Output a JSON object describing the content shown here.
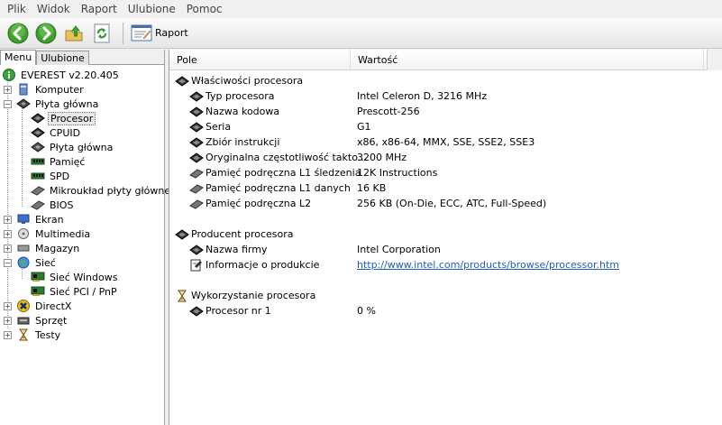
{
  "menu": [
    "Plik",
    "Widok",
    "Raport",
    "Ulubione",
    "Pomoc"
  ],
  "toolbar": {
    "report_label": "Raport"
  },
  "tabs": {
    "menu": "Menu",
    "favorites": "Ulubione"
  },
  "tree": {
    "root": "EVEREST v2.20.405",
    "komputer": "Komputer",
    "plyta": "Płyta główna",
    "procesor": "Procesor",
    "cpuid": "CPUID",
    "plyta_sub": "Płyta główna",
    "pamiec": "Pamięć",
    "spd": "SPD",
    "chipset": "Mikroukład płyty głównej",
    "bios": "BIOS",
    "ekran": "Ekran",
    "multimedia": "Multimedia",
    "magazyn": "Magazyn",
    "siec": "Sieć",
    "siec_windows": "Sieć Windows",
    "siec_pci": "Sieć PCI / PnP",
    "directx": "DirectX",
    "sprzet": "Sprzęt",
    "testy": "Testy"
  },
  "columns": {
    "field": "Pole",
    "value": "Wartość"
  },
  "groups": {
    "props": "Właściwości procesora",
    "vendor": "Producent procesora",
    "usage": "Wykorzystanie procesora"
  },
  "props": [
    {
      "field": "Typ procesora",
      "value": "Intel Celeron D, 3216 MHz"
    },
    {
      "field": "Nazwa kodowa",
      "value": "Prescott-256"
    },
    {
      "field": "Seria",
      "value": "G1"
    },
    {
      "field": "Zbiór instrukcji",
      "value": "x86, x86-64, MMX, SSE, SSE2, SSE3"
    },
    {
      "field": "Oryginalna częstotliwość takto...",
      "value": "3200 MHz"
    },
    {
      "field": "Pamięć podręczna L1 śledzenia",
      "value": "12K Instructions"
    },
    {
      "field": "Pamięć podręczna L1 danych",
      "value": "16 KB"
    },
    {
      "field": "Pamięć podręczna L2",
      "value": "256 KB  (On-Die, ECC, ATC, Full-Speed)"
    }
  ],
  "vendor": [
    {
      "field": "Nazwa firmy",
      "value": "Intel Corporation"
    },
    {
      "field": "Informacje o produkcie",
      "value": "http://www.intel.com/products/browse/processor.htm"
    }
  ],
  "usage": [
    {
      "field": "Procesor nr 1",
      "value": "0 %"
    }
  ]
}
